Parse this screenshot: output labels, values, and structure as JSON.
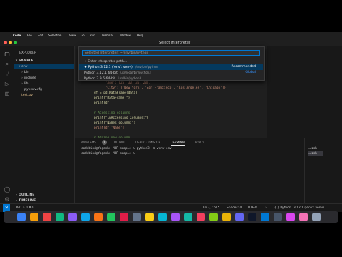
{
  "menubar": {
    "apple": "",
    "items": [
      "Code",
      "File",
      "Edit",
      "Selection",
      "View",
      "Go",
      "Run",
      "Terminal",
      "Window",
      "Help"
    ]
  },
  "quickpick": {
    "title": "Select Interpreter",
    "placeholder": "Selected Interpreter: ~/env/bin/python",
    "items": [
      {
        "label": "+ Enter interpreter path...",
        "desc": "",
        "right": ""
      },
      {
        "label": "★ Python 3.12.1 ('env': venv)",
        "desc": "./env/bin/python",
        "right": "Recommended"
      },
      {
        "label": "Python 3.12.1 64-bit",
        "desc": "/usr/local/bin/python3",
        "right": "Global"
      },
      {
        "label": "Python 3.9.6 64-bit",
        "desc": "/usr/bin/python3",
        "right": ""
      }
    ]
  },
  "explorer": {
    "title": "EXPLORER",
    "root": "SAMPLE",
    "items": [
      {
        "label": "env",
        "chev": "∨",
        "indent": 1,
        "sel": true
      },
      {
        "label": "bin",
        "chev": "›",
        "indent": 2
      },
      {
        "label": "include",
        "chev": "›",
        "indent": 2
      },
      {
        "label": "lib",
        "chev": "›",
        "indent": 2
      },
      {
        "label": "pyvenv.cfg",
        "chev": "",
        "indent": 2
      },
      {
        "label": "test.py",
        "chev": "",
        "indent": 1,
        "file": true
      }
    ],
    "outline": "OUTLINE",
    "timeline": "TIMELINE"
  },
  "editor": {
    "lines": [
      "      'Age': [25, 30, 35, 28],",
      "      'City': ['New York', 'San Francisco', 'Los Angeles', 'Chicago']}",
      "df = pd.DataFrame(data)",
      "print(\"DataFrame:\")",
      "print(df)",
      "",
      "# Accessing columns",
      "print(\"\\nAccessing Columns:\")",
      "print(\"Names column:\")",
      "print(df['Name'])",
      "",
      "# Adding new column"
    ]
  },
  "panel": {
    "tabs": [
      "PROBLEMS",
      "OUTPUT",
      "DEBUG CONSOLE",
      "TERMINAL",
      "PORTS"
    ],
    "problems_count": "1",
    "terminal_lines": [
      "codebind@Yogeshs-MBP sample % python3 -m venv env",
      "codebind@Yogeshs-MBP sample % "
    ],
    "terminal_list": [
      "zsh",
      "zsh"
    ]
  },
  "status": {
    "left": "⊗ 0 ⚠ 1   ⌗ 0",
    "right_items": [
      "Ln 3, Col 5",
      "Spaces: 4",
      "UTF-8",
      "LF",
      "{ } Python",
      "3.12.1 ('env': venv)"
    ]
  },
  "colors": {
    "accent": "#0078d4",
    "selection": "#04395e",
    "recommended": "#ffffff"
  }
}
